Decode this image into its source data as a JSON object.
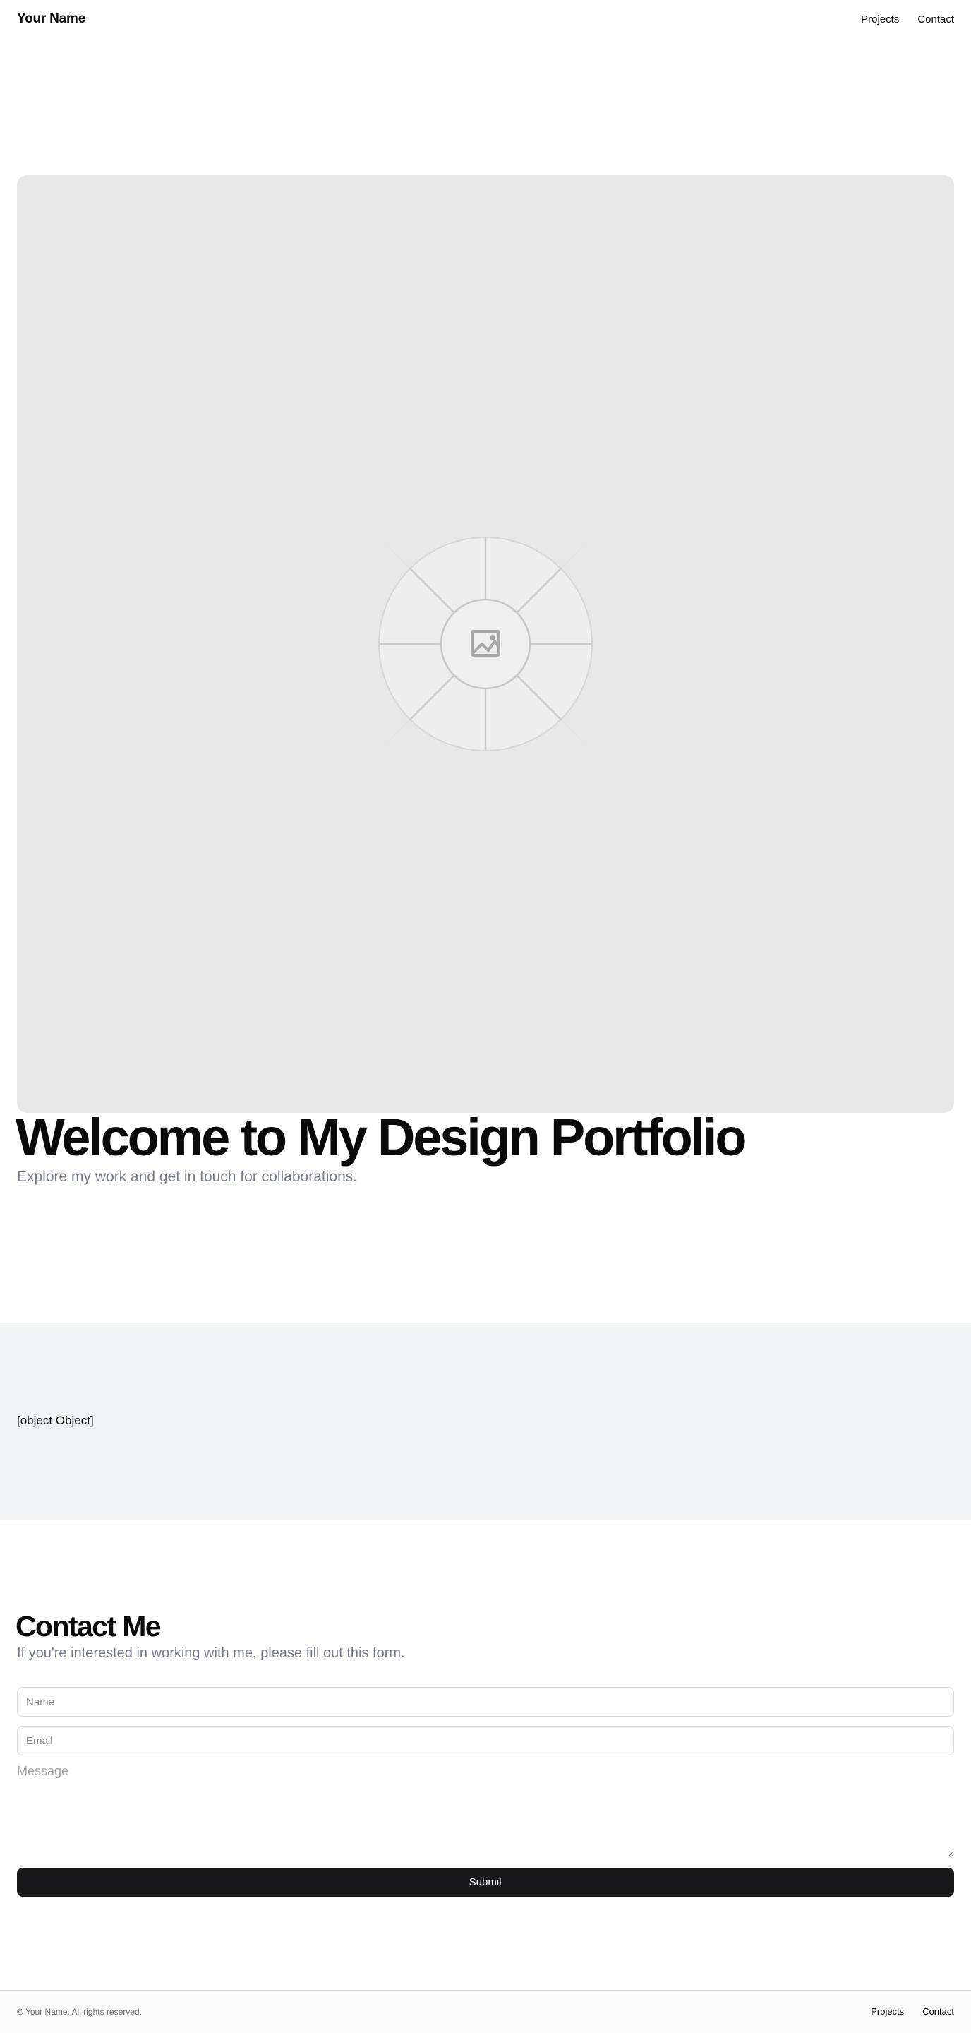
{
  "header": {
    "brand": "Your Name",
    "nav": {
      "projects": "Projects",
      "contact": "Contact"
    }
  },
  "hero": {
    "image_icon": "image-placeholder-icon",
    "title": "Welcome to My Design Portfolio",
    "subtitle": "Explore my work and get in touch for collaborations."
  },
  "projects": {
    "content": "[object Object]"
  },
  "contact": {
    "title": "Contact Me",
    "subtitle": "If you're interested in working with me, please fill out this form.",
    "name_placeholder": "Name",
    "email_placeholder": "Email",
    "message_placeholder": "Message",
    "submit_label": "Submit"
  },
  "footer": {
    "copyright": "© Your Name. All rights reserved.",
    "nav": {
      "projects": "Projects",
      "contact": "Contact"
    }
  },
  "colors": {
    "accent_button": "#18181b",
    "muted_text": "#737b8c",
    "band_background": "#f2f3f5",
    "placeholder_background": "#e8e8e8"
  }
}
